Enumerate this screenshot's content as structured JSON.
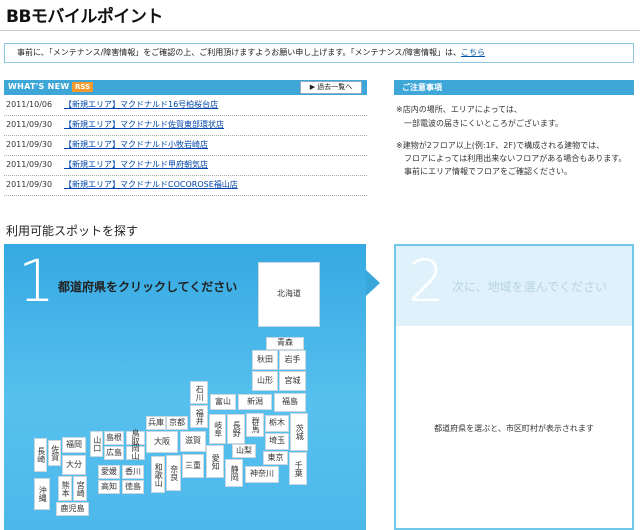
{
  "site_title": "BBモバイルポイント",
  "notice": {
    "text": "事前に、「メンテナンス/障害情報」をご確認の上、ご利用頂けますようお願い申し上げます。「メンテナンス/障害情報」は、",
    "link": "こちら"
  },
  "news": {
    "header_label": "WHAT'S NEW",
    "rss_label": "RSS",
    "archive_button": "▶ 過去一覧へ",
    "items": [
      {
        "date": "2011/10/06",
        "title": "【新規エリア】マクドナルド16号柏桜台店"
      },
      {
        "date": "2011/09/30",
        "title": "【新規エリア】マクドナルド佐賀東部環状店"
      },
      {
        "date": "2011/09/30",
        "title": "【新規エリア】マクドナルド小牧岩崎店"
      },
      {
        "date": "2011/09/30",
        "title": "【新規エリア】マクドナルド甲府朝気店"
      },
      {
        "date": "2011/09/30",
        "title": "【新規エリア】マクドナルドCOCOROSE福山店"
      }
    ]
  },
  "caution": {
    "title": "ご注意事項",
    "lines": [
      "※店内の場所、エリアによっては、",
      "一部電波の届きにくいところがございます。",
      "※建物が2フロア以上(例:1F、2F)で構成される建物では、",
      "フロアによっては利用出来ないフロアがある場合もあります。",
      "事前にエリア情報でフロアをご確認ください。"
    ]
  },
  "spot_heading": "利用可能スポットを探す",
  "step1": {
    "number": "1",
    "text": "都道府県をクリックしてください"
  },
  "step2": {
    "number": "2",
    "text": "次に、地域を選んでください",
    "message": "都道府県を選ぶと、市区町村が表示されます"
  },
  "prefectures": {
    "hokkaido": "北海道",
    "aomori": "青森",
    "akita": "秋田",
    "iwate": "岩手",
    "yamagata": "山形",
    "miyagi": "宮城",
    "ishikawa": "石川",
    "toyama": "富山",
    "niigata": "新潟",
    "fukushima": "福島",
    "fukui": "福井",
    "gunma": "群馬",
    "tochigi": "栃木",
    "ibaraki": "茨城",
    "saitama": "埼玉",
    "nagano": "長野",
    "gifu": "岐阜",
    "yamanashi": "山梨",
    "tokyo": "東京",
    "chiba": "千葉",
    "kanagawa": "神奈川",
    "shizuoka": "静岡",
    "aichi": "愛知",
    "mie": "三重",
    "shiga": "滋賀",
    "kyoto": "京都",
    "osaka": "大阪",
    "hyogo": "兵庫",
    "nara": "奈良",
    "wakayama": "和歌山",
    "tottori": "鳥取",
    "shimane": "島根",
    "okayama": "岡山",
    "hiroshima": "広島",
    "yamaguchi": "山口",
    "kagawa": "香川",
    "tokushima": "徳島",
    "ehime": "愛媛",
    "kochi": "高知",
    "fukuoka": "福岡",
    "saga": "佐賀",
    "nagasaki": "長崎",
    "oita": "大分",
    "kumamoto": "熊本",
    "miyazaki": "宮崎",
    "kagoshima": "鹿児島",
    "okinawa": "沖縄"
  }
}
